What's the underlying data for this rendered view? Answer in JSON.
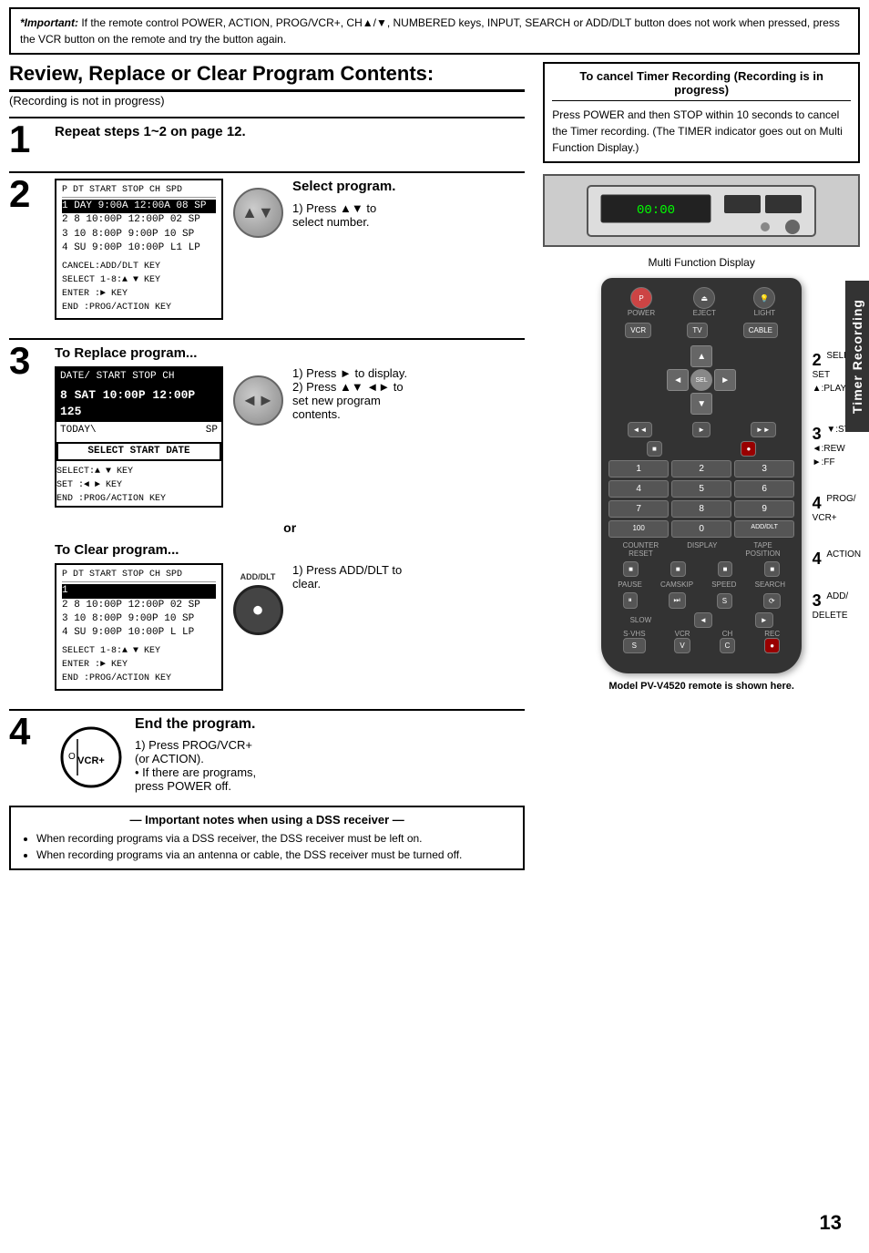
{
  "banner": {
    "label": "*Important:",
    "text": "If the remote control POWER, ACTION, PROG/VCR+, CH▲/▼, NUMBERED keys, INPUT, SEARCH or ADD/DLT button does not work when pressed, press the VCR button on the remote and try the button again."
  },
  "page_title": "Review, Replace or Clear Program Contents:",
  "page_subtitle": "(Recording is not in progress)",
  "steps": [
    {
      "number": "1",
      "title": "Repeat steps 1~2 on page 12.",
      "has_screen": false
    },
    {
      "number": "2",
      "title": "Select program.",
      "screen": {
        "header": "P DT START  STOP  CH SPD",
        "rows": [
          "1 DAY  9:00A 12:00A  08  SP",
          "2   8 10:00P 12:00P  02  SP",
          "3  10  8:00P  9:00P  10  SP",
          "4  SU  9:00P 10:00P  L1  LP"
        ],
        "instructions": [
          "CANCEL:ADD/DLT KEY",
          "SELECT 1-8:▲ ▼ KEY",
          "ENTER :► KEY",
          "END    :PROG/ACTION KEY"
        ],
        "highlighted_row": 0
      },
      "instructions": [
        "1) Press ▲▼ to",
        "select number."
      ]
    },
    {
      "number": "3",
      "title_replace": "To Replace program...",
      "screen_replace": {
        "header": "DATE/ START  STOP  CH",
        "highlighted": "8 SAT 10:00P 12:00P 125",
        "row2": "TODAY\\",
        "row2b": "SP",
        "select_date": "SELECT START DATE",
        "instructions": [
          "SELECT:▲ ▼ KEY",
          "SET    :◄ ► KEY",
          "END    :PROG/ACTION KEY"
        ]
      },
      "instructions_replace": [
        "1) Press ► to display.",
        "2) Press ▲▼ ◄► to",
        "set new program",
        "contents."
      ],
      "title_clear": "To Clear program...",
      "screen_clear": {
        "header": "P DT START  STOP  CH SPD",
        "rows": [
          "1",
          "2  8 10:00P 12:00P  02  SP",
          "3 10  8:00P  9:00P  10  SP",
          "4 SU  9:00P 10:00P   L  LP"
        ],
        "instructions": [
          "SELECT 1-8:▲ ▼ KEY",
          "ENTER :► KEY",
          "END    :PROG/ACTION KEY"
        ],
        "highlighted_row": 0
      },
      "instructions_clear": [
        "1) Press ADD/DLT to",
        "clear."
      ]
    },
    {
      "number": "4",
      "title": "End the program.",
      "instructions": [
        "1) Press PROG/VCR+",
        "(or ACTION).",
        "• If there are programs,",
        "press POWER off."
      ]
    }
  ],
  "cancel_timer_box": {
    "title": "To cancel Timer Recording (Recording is in progress)",
    "text": "Press POWER and then STOP within 10 seconds to cancel the Timer recording. (The TIMER indicator goes out on Multi Function Display.)"
  },
  "multi_function_label": "Multi Function Display",
  "annotations": [
    {
      "num": "2",
      "lines": [
        "SELECT/",
        "SET",
        "▲:PLAY"
      ]
    },
    {
      "num": "3",
      "lines": [
        "▼:STOP",
        "◄:REW",
        "►:FF"
      ]
    },
    {
      "num": "4",
      "lines": [
        "PROG/",
        "VCR+"
      ]
    },
    {
      "num": "4",
      "lines": [
        "ACTION"
      ]
    },
    {
      "num": "3",
      "lines": [
        "ADD/",
        "DELETE"
      ]
    }
  ],
  "notes": {
    "title": "Important notes when using a DSS receiver",
    "items": [
      "When recording programs via a DSS receiver, the DSS receiver must be left on.",
      "When recording programs via an antenna or cable, the DSS receiver must be turned off."
    ]
  },
  "model_label": "Model PV-V4520 remote is shown here.",
  "page_number": "13",
  "side_tab": "Timer Recording",
  "remote": {
    "top_buttons": [
      "POWER",
      "EJECT",
      "LIGHT"
    ],
    "mode_buttons": [
      "VCR",
      "TV",
      "CABLE"
    ],
    "transport": [
      "REW",
      "PLAY",
      "FF"
    ],
    "transport2": [
      "◄◄",
      "SELECT",
      "►"
    ],
    "stop": "STOP",
    "numpad": [
      "1",
      "2",
      "3",
      "4",
      "5",
      "6",
      "7",
      "8",
      "9",
      "100",
      "0",
      "ADD/DLT"
    ],
    "bottom_labels": [
      "COUNTER RESET",
      "DISPLAY",
      "TAPE POSITION"
    ],
    "bottom2": [
      "PAUSE",
      "CAMSKIP",
      "SPEED",
      "SEARCH"
    ],
    "bottom3": [
      "SLOW"
    ],
    "svhs": "S·VHS",
    "bottom4": [
      "VCR",
      "CH",
      "REC"
    ]
  }
}
